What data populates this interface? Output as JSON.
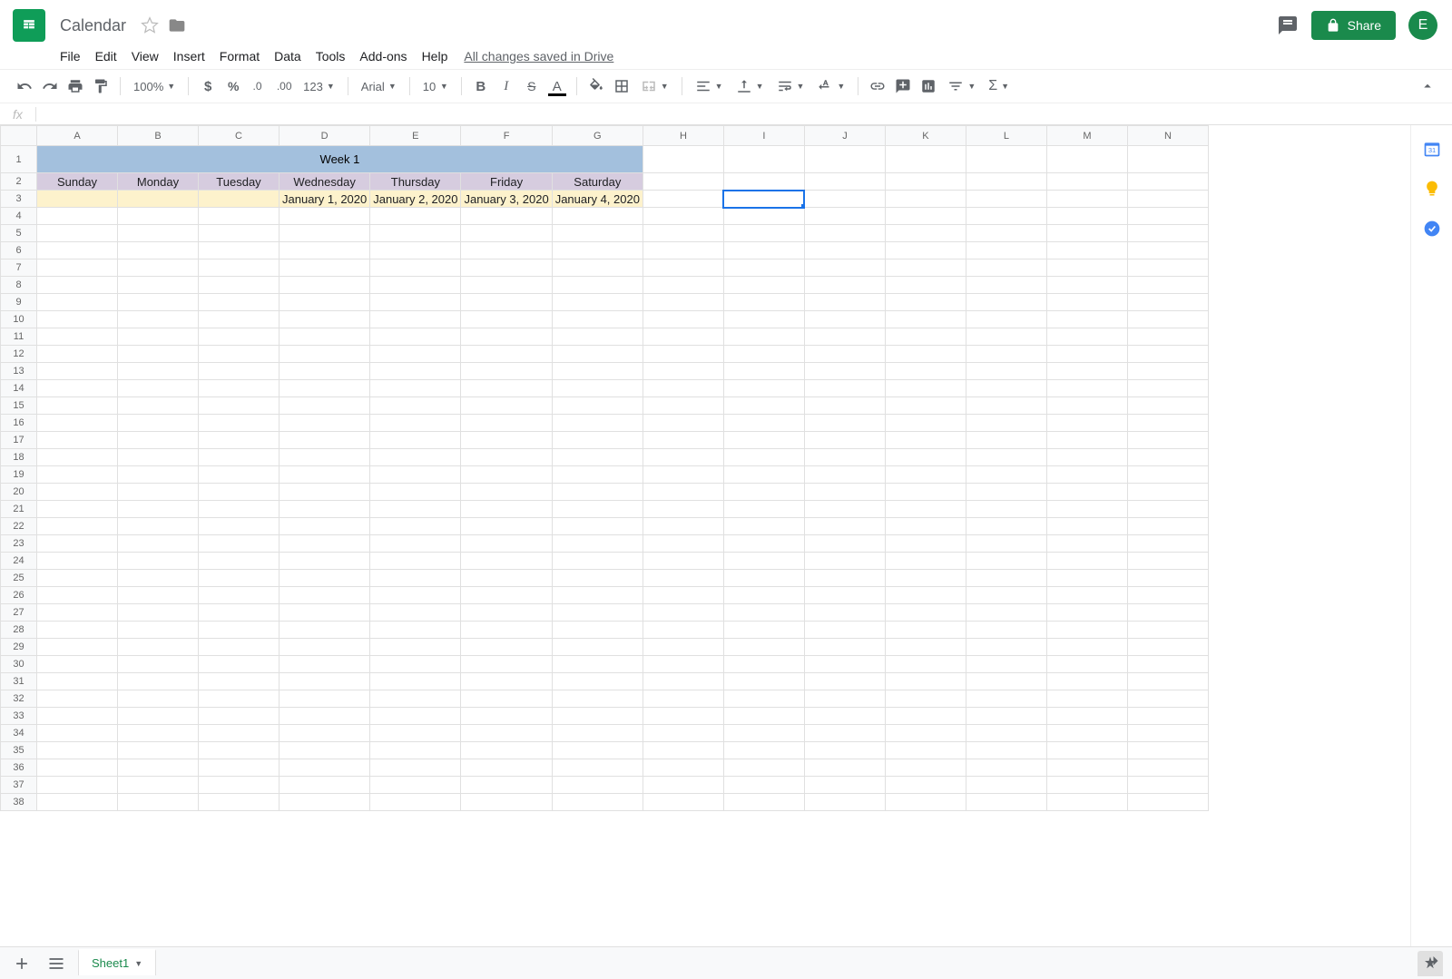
{
  "doc": {
    "title": "Calendar",
    "save_status": "All changes saved in Drive"
  },
  "menus": [
    "File",
    "Edit",
    "View",
    "Insert",
    "Format",
    "Data",
    "Tools",
    "Add-ons",
    "Help"
  ],
  "toolbar": {
    "zoom": "100%",
    "font": "Arial",
    "font_size": "10",
    "fmt123": "123"
  },
  "share": {
    "label": "Share"
  },
  "avatar": {
    "initial": "E"
  },
  "formula": {
    "fx": "fx",
    "value": ""
  },
  "columns": [
    "A",
    "B",
    "C",
    "D",
    "E",
    "F",
    "G",
    "H",
    "I",
    "J",
    "K",
    "L",
    "M",
    "N"
  ],
  "row_count": 38,
  "selected_cell": "I3",
  "content": {
    "week_title": "Week 1",
    "days": [
      "Sunday",
      "Monday",
      "Tuesday",
      "Wednesday",
      "Thursday",
      "Friday",
      "Saturday"
    ],
    "dates": [
      "",
      "",
      "",
      "January 1, 2020",
      "January 2, 2020",
      "January 3, 2020",
      "January 4, 2020"
    ]
  },
  "sheets": {
    "active": "Sheet1"
  },
  "colors": {
    "week_bg": "#a3c0dd",
    "day_bg": "#d6ccdf",
    "date_bg": "#fdf2cc",
    "select": "#1a73e8",
    "green": "#1a8a4c"
  }
}
